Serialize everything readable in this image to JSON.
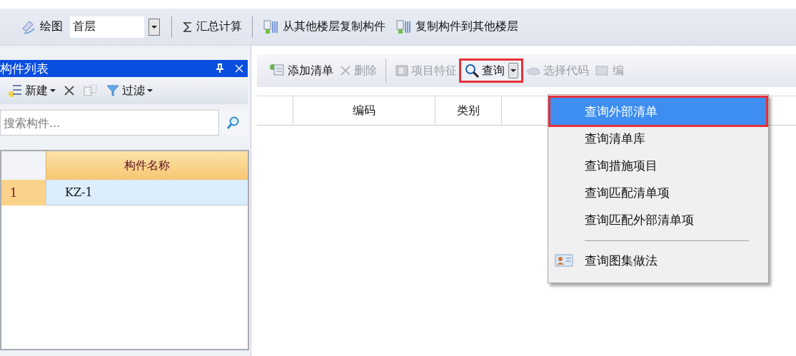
{
  "main_toolbar": {
    "items": [
      {
        "kind": "button",
        "label": "绘图"
      },
      {
        "kind": "combo",
        "value": "首层"
      },
      {
        "kind": "separator"
      },
      {
        "kind": "button",
        "label": "汇总计算"
      },
      {
        "kind": "separator"
      },
      {
        "kind": "button",
        "label": "从其他楼层复制构件"
      },
      {
        "kind": "button",
        "label": "复制构件到其他楼层"
      }
    ]
  },
  "component_panel": {
    "title": "构件列表",
    "toolbar": [
      {
        "kind": "button",
        "label": "新建",
        "dropdown": true
      },
      {
        "kind": "icon"
      },
      {
        "kind": "icon"
      },
      {
        "kind": "button",
        "label": "过滤",
        "dropdown": true
      }
    ],
    "search": {
      "placeholder": "搜索构件..."
    },
    "grid": {
      "columns": [
        "构件名称"
      ],
      "rows": [
        {
          "index": "1",
          "name": "KZ-1",
          "selected": true
        }
      ]
    }
  },
  "list_toolbar": {
    "items": [
      {
        "kind": "button",
        "label": "添加清单",
        "disabled": false,
        "annotated": false,
        "dropdown": false
      },
      {
        "kind": "button",
        "label": "删除",
        "disabled": true,
        "annotated": false,
        "dropdown": false
      },
      {
        "kind": "separator"
      },
      {
        "kind": "button",
        "label": "项目特征",
        "disabled": true,
        "annotated": false,
        "dropdown": false
      },
      {
        "kind": "button",
        "label": "查询",
        "disabled": false,
        "annotated": true,
        "dropdown": true
      },
      {
        "kind": "button",
        "label": "选择代码",
        "disabled": true,
        "annotated": false,
        "dropdown": false
      },
      {
        "kind": "button",
        "label": "编",
        "disabled": true,
        "annotated": false,
        "dropdown": false
      }
    ]
  },
  "list_table": {
    "columns": [
      "编码",
      "类别"
    ]
  },
  "query_menu": {
    "items": [
      {
        "kind": "item",
        "label": "查询外部清单",
        "selected": true,
        "annotated": true
      },
      {
        "kind": "item",
        "label": "查询清单库",
        "selected": false,
        "annotated": false
      },
      {
        "kind": "item",
        "label": "查询措施项目",
        "selected": false,
        "annotated": false
      },
      {
        "kind": "item",
        "label": "查询匹配清单项",
        "selected": false,
        "annotated": false
      },
      {
        "kind": "item",
        "label": "查询匹配外部清单项",
        "selected": false,
        "annotated": false
      },
      {
        "kind": "separator"
      },
      {
        "kind": "icon-item",
        "label": "查询图集做法",
        "selected": false,
        "annotated": false
      }
    ]
  }
}
